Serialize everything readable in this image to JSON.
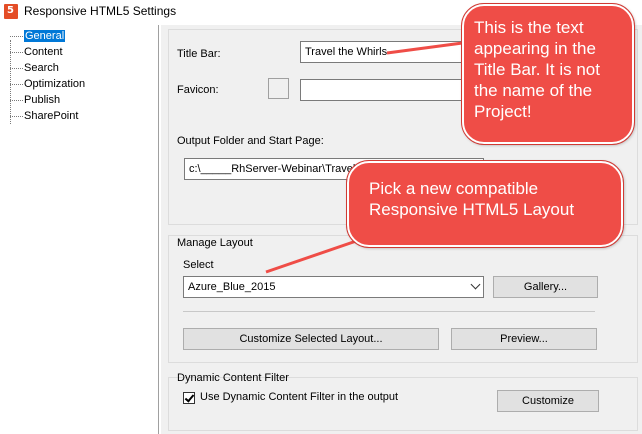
{
  "window": {
    "title": "Responsive HTML5 Settings"
  },
  "tree": {
    "items": [
      "General",
      "Content",
      "Search",
      "Optimization",
      "Publish",
      "SharePoint"
    ],
    "selected": "General"
  },
  "general": {
    "title_bar_label": "Title Bar:",
    "title_bar_value": "Travel the Whirls",
    "favicon_label": "Favicon:",
    "favicon_value": "",
    "output_label": "Output Folder and Start Page:",
    "output_value": "c:\\_____RhServer-Webinar\\Travel"
  },
  "layout": {
    "group_label": "Manage Layout",
    "select_label": "Select",
    "selected_layout": "Azure_Blue_2015",
    "gallery_button": "Gallery...",
    "customize_button": "Customize Selected Layout...",
    "preview_button": "Preview..."
  },
  "filter": {
    "group_label": "Dynamic Content Filter",
    "checkbox_label": "Use Dynamic Content Filter in the output",
    "checked": true,
    "customize_button": "Customize"
  },
  "callouts": {
    "title_bar_note": "This is the text appearing in the Title Bar. It is not the name of the Project!",
    "layout_note": "Pick a new compatible Responsive HTML5 Layout"
  },
  "colors": {
    "callout": "#ef4d47",
    "selection": "#0078d7",
    "html5_icon": "#e44d26"
  }
}
